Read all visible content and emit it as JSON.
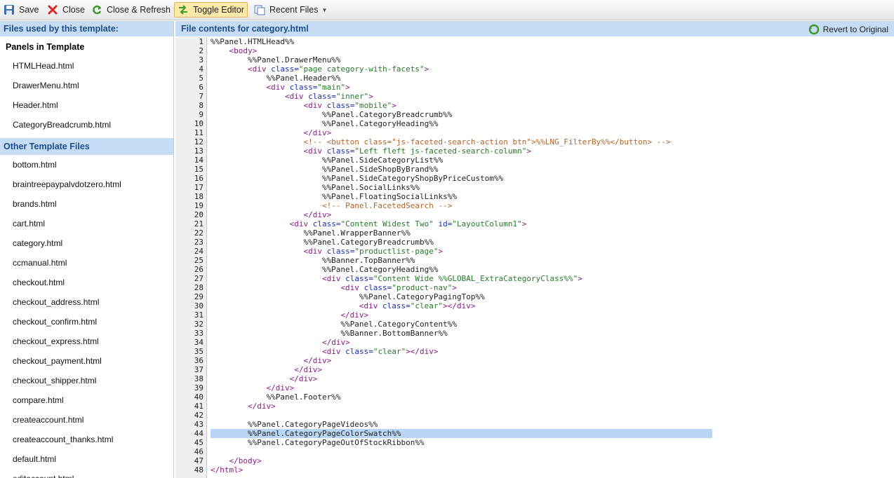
{
  "toolbar": {
    "buttons": [
      {
        "label": "Save",
        "icon": "save-icon",
        "active": false
      },
      {
        "label": "Close",
        "icon": "close-icon",
        "active": false
      },
      {
        "label": "Close & Refresh",
        "icon": "refresh-icon",
        "active": false
      },
      {
        "label": "Toggle Editor",
        "icon": "toggle-editor-icon",
        "active": true
      },
      {
        "label": "Recent Files",
        "icon": "recent-files-icon",
        "active": false,
        "dropdown": true
      }
    ]
  },
  "left_panel": {
    "header": "Files used by this template:",
    "panels_title": "Panels in Template",
    "panels": [
      "HTMLHead.html",
      "DrawerMenu.html",
      "Header.html",
      "CategoryBreadcrumb.html"
    ],
    "other_header": "Other Template Files",
    "other_files": [
      "bottom.html",
      "braintreepaypalvdotzero.html",
      "brands.html",
      "cart.html",
      "category.html",
      "ccmanual.html",
      "checkout.html",
      "checkout_address.html",
      "checkout_confirm.html",
      "checkout_express.html",
      "checkout_payment.html",
      "checkout_shipper.html",
      "compare.html",
      "createaccount.html",
      "createaccount_thanks.html",
      "default.html",
      "editaccount.html"
    ]
  },
  "editor": {
    "header": "File contents for category.html",
    "revert_label": "Revert to Original",
    "highlighted_line": 44,
    "lines": [
      [
        [
          "pl",
          "%%Panel.HTMLHead%%"
        ]
      ],
      [
        [
          "pl",
          "    "
        ],
        [
          "tag",
          "<body>"
        ]
      ],
      [
        [
          "pl",
          "        %%Panel.DrawerMenu%%"
        ]
      ],
      [
        [
          "pl",
          "        "
        ],
        [
          "tag",
          "<div "
        ],
        [
          "attr",
          "class="
        ],
        [
          "str",
          "\"page category-with-facets\""
        ],
        [
          "tag",
          ">"
        ]
      ],
      [
        [
          "pl",
          "            %%Panel.Header%%"
        ]
      ],
      [
        [
          "pl",
          "            "
        ],
        [
          "tag",
          "<div "
        ],
        [
          "attr",
          "class="
        ],
        [
          "str",
          "\"main\""
        ],
        [
          "tag",
          ">"
        ]
      ],
      [
        [
          "pl",
          "                "
        ],
        [
          "tag",
          "<div "
        ],
        [
          "attr",
          "class="
        ],
        [
          "str",
          "\"inner\""
        ],
        [
          "tag",
          ">"
        ]
      ],
      [
        [
          "pl",
          "                    "
        ],
        [
          "tag",
          "<div "
        ],
        [
          "attr",
          "class="
        ],
        [
          "str",
          "\"mobile\""
        ],
        [
          "tag",
          ">"
        ]
      ],
      [
        [
          "pl",
          "                        %%Panel.CategoryBreadcrumb%%"
        ]
      ],
      [
        [
          "pl",
          "                        %%Panel.CategoryHeading%%"
        ]
      ],
      [
        [
          "pl",
          "                    "
        ],
        [
          "tag",
          "</div>"
        ]
      ],
      [
        [
          "pl",
          "                    "
        ],
        [
          "cmt",
          "<!-- <button class=\"js-faceted-search-action btn\">%%LNG_FilterBy%%</button> -->"
        ]
      ],
      [
        [
          "pl",
          "                    "
        ],
        [
          "tag",
          "<div "
        ],
        [
          "attr",
          "class="
        ],
        [
          "str",
          "\"Left fleft js-faceted-search-column\""
        ],
        [
          "tag",
          ">"
        ]
      ],
      [
        [
          "pl",
          "                        %%Panel.SideCategoryList%%"
        ]
      ],
      [
        [
          "pl",
          "                        %%Panel.SideShopByBrand%%"
        ]
      ],
      [
        [
          "pl",
          "                        %%Panel.SideCategoryShopByPriceCustom%%"
        ]
      ],
      [
        [
          "pl",
          "                        %%Panel.SocialLinks%%"
        ]
      ],
      [
        [
          "pl",
          "                        %%Panel.FloatingSocialLinks%%"
        ]
      ],
      [
        [
          "pl",
          "                        "
        ],
        [
          "cmt",
          "<!-- Panel.FacetedSearch -->"
        ]
      ],
      [
        [
          "pl",
          "                    "
        ],
        [
          "tag",
          "</div>"
        ]
      ],
      [
        [
          "pl",
          "                 "
        ],
        [
          "tag",
          "<div "
        ],
        [
          "attr",
          "class="
        ],
        [
          "str",
          "\"Content Widest Two\""
        ],
        [
          "attr",
          " id="
        ],
        [
          "str",
          "\"LayoutColumn1\""
        ],
        [
          "tag",
          ">"
        ]
      ],
      [
        [
          "pl",
          "                    %%Panel.WrapperBanner%%"
        ]
      ],
      [
        [
          "pl",
          "                    %%Panel.CategoryBreadcrumb%%"
        ]
      ],
      [
        [
          "pl",
          "                    "
        ],
        [
          "tag",
          "<div "
        ],
        [
          "attr",
          "class="
        ],
        [
          "str",
          "\"productlist-page\""
        ],
        [
          "tag",
          ">"
        ]
      ],
      [
        [
          "pl",
          "                        %%Banner.TopBanner%%"
        ]
      ],
      [
        [
          "pl",
          "                        %%Panel.CategoryHeading%%"
        ]
      ],
      [
        [
          "pl",
          "                        "
        ],
        [
          "tag",
          "<div "
        ],
        [
          "attr",
          "class="
        ],
        [
          "str",
          "\"Content Wide %%GLOBAL_ExtraCategoryClass%%\""
        ],
        [
          "tag",
          ">"
        ]
      ],
      [
        [
          "pl",
          "                            "
        ],
        [
          "tag",
          "<div "
        ],
        [
          "attr",
          "class="
        ],
        [
          "str",
          "\"product-nav\""
        ],
        [
          "tag",
          ">"
        ]
      ],
      [
        [
          "pl",
          "                                %%Panel.CategoryPagingTop%%"
        ]
      ],
      [
        [
          "pl",
          "                                "
        ],
        [
          "tag",
          "<div "
        ],
        [
          "attr",
          "class="
        ],
        [
          "str",
          "\"clear\""
        ],
        [
          "tag",
          "></div>"
        ]
      ],
      [
        [
          "pl",
          "                            "
        ],
        [
          "tag",
          "</div>"
        ]
      ],
      [
        [
          "pl",
          "                            %%Panel.CategoryContent%%"
        ]
      ],
      [
        [
          "pl",
          "                            %%Banner.BottomBanner%%"
        ]
      ],
      [
        [
          "pl",
          "                        "
        ],
        [
          "tag",
          "</div>"
        ]
      ],
      [
        [
          "pl",
          "                        "
        ],
        [
          "tag",
          "<div "
        ],
        [
          "attr",
          "class="
        ],
        [
          "str",
          "\"clear\""
        ],
        [
          "tag",
          "></div>"
        ]
      ],
      [
        [
          "pl",
          "                    "
        ],
        [
          "tag",
          "</div>"
        ]
      ],
      [
        [
          "pl",
          "                  "
        ],
        [
          "tag",
          "</div>"
        ]
      ],
      [
        [
          "pl",
          "                 "
        ],
        [
          "tag",
          "</div>"
        ]
      ],
      [
        [
          "pl",
          "            "
        ],
        [
          "tag",
          "</div>"
        ]
      ],
      [
        [
          "pl",
          "            %%Panel.Footer%%"
        ]
      ],
      [
        [
          "pl",
          "        "
        ],
        [
          "tag",
          "</div>"
        ]
      ],
      [
        [
          "pl",
          ""
        ]
      ],
      [
        [
          "pl",
          "        %%Panel.CategoryPageVideos%%"
        ]
      ],
      [
        [
          "pl",
          "        %%Panel.CategoryPageColorSwatch%%"
        ]
      ],
      [
        [
          "pl",
          "        %%Panel.CategoryPageOutOfStockRibbon%%"
        ]
      ],
      [
        [
          "pl",
          ""
        ]
      ],
      [
        [
          "pl",
          "    "
        ],
        [
          "tag",
          "</body>"
        ]
      ],
      [
        [
          "tag",
          "</html>"
        ]
      ]
    ]
  }
}
